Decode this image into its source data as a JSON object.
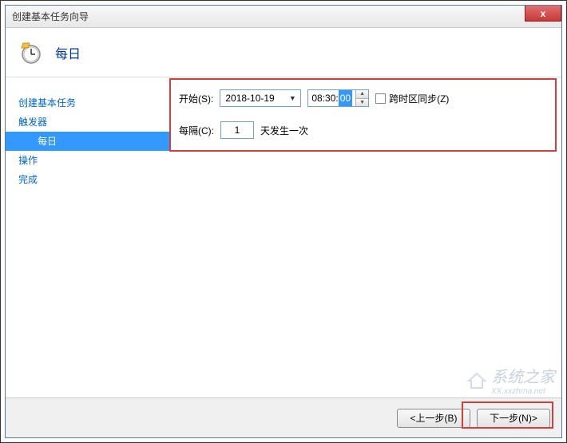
{
  "window": {
    "title": "创建基本任务向导",
    "close_text": "x"
  },
  "header": {
    "title": "每日"
  },
  "sidebar": {
    "items": [
      {
        "label": "创建基本任务",
        "indent": false,
        "selected": false
      },
      {
        "label": "触发器",
        "indent": false,
        "selected": false
      },
      {
        "label": "每日",
        "indent": true,
        "selected": true
      },
      {
        "label": "操作",
        "indent": false,
        "selected": false
      },
      {
        "label": "完成",
        "indent": false,
        "selected": false
      }
    ]
  },
  "form": {
    "start_label": "开始(S):",
    "date_value": "2018-10-19",
    "time_prefix": "08:30:",
    "time_selected": "00",
    "sync_label": "跨时区同步(Z)",
    "sync_checked": false,
    "recur_label": "每隔(C):",
    "recur_value": "1",
    "recur_suffix": "天发生一次"
  },
  "footer": {
    "back_label": "<上一步(B)",
    "next_label": "下一步(N)>"
  },
  "watermark": {
    "text": "系统之家",
    "url": "XX.xxzhrna.net"
  }
}
